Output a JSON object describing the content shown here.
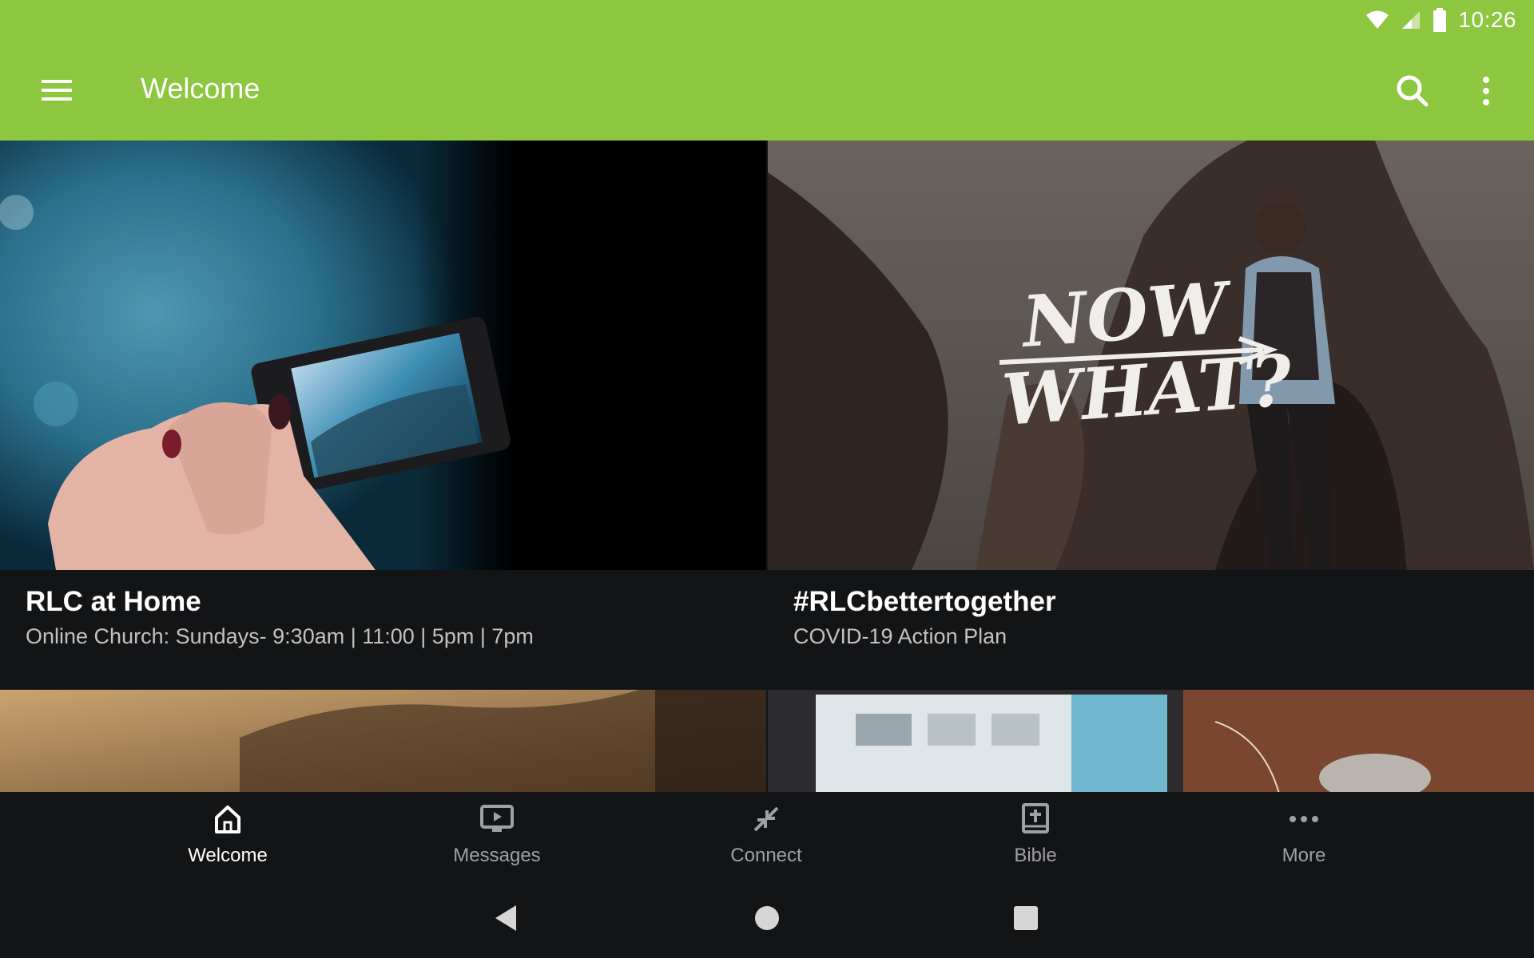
{
  "status_bar": {
    "time": "10:26"
  },
  "toolbar": {
    "title": "Welcome"
  },
  "cards": [
    {
      "title": "RLC at Home",
      "subtitle": "Online Church: Sundays- 9:30am | 11:00 | 5pm | 7pm"
    },
    {
      "title": "#RLCbettertogether",
      "subtitle": "COVID-19 Action Plan",
      "image_text": "NOW WHAT?"
    }
  ],
  "bottom_nav": [
    {
      "label": "Welcome",
      "icon": "home-icon",
      "active": true
    },
    {
      "label": "Messages",
      "icon": "tv-play-icon",
      "active": false
    },
    {
      "label": "Connect",
      "icon": "connect-arrows-icon",
      "active": false
    },
    {
      "label": "Bible",
      "icon": "bible-icon",
      "active": false
    },
    {
      "label": "More",
      "icon": "more-horizontal-icon",
      "active": false
    }
  ],
  "colors": {
    "app_bar": "#8dc63f",
    "background": "#131416",
    "active_nav": "#ffffff",
    "inactive_nav": "#9ea0a4"
  }
}
